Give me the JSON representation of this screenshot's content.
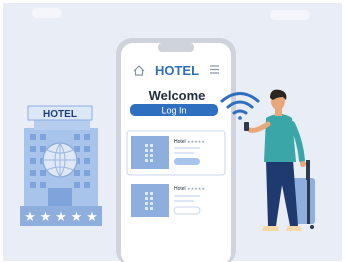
{
  "building": {
    "sign": "HOTEL",
    "stars": 5,
    "star_glyph": "★"
  },
  "phone": {
    "app_title": "HOTEL",
    "welcome": "Welcome",
    "login_label": "Log In",
    "cards": [
      {
        "name": "Hotel",
        "stars": "★★★★★"
      },
      {
        "name": "Hotel",
        "stars": "★★★★★"
      }
    ]
  },
  "colors": {
    "background": "#e9edf6",
    "brand_blue": "#2f6fc0",
    "light_blue": "#a9c4ea",
    "phone_frame": "#cfd3db",
    "shirt_teal": "#3aa6a8",
    "jeans_navy": "#1e3a6e"
  },
  "icons": {
    "home": "home-icon",
    "menu": "hamburger-menu-icon",
    "wifi": "wifi-icon",
    "card_building": "building-thumbnail-icon"
  }
}
